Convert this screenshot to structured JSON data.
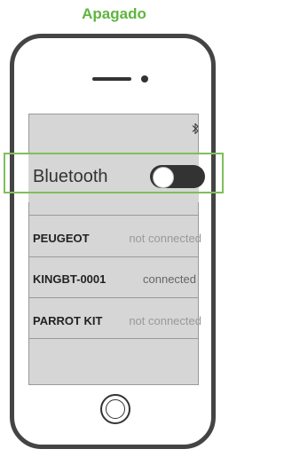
{
  "state_label": "Apagado",
  "bluetooth": {
    "label": "Bluetooth",
    "enabled": false
  },
  "devices": [
    {
      "name": "PEUGEOT",
      "status": "not connected"
    },
    {
      "name": "KINGBT-0001",
      "status": "connected"
    },
    {
      "name": "PARROT KIT",
      "status": "not connected"
    }
  ],
  "icons": {
    "status": "bluetooth-icon",
    "home": "home-button"
  },
  "colors": {
    "title": "#5fb53f",
    "highlight": "#7dbf5c",
    "screen": "#d6d6d6",
    "toggle_off": "#333333"
  }
}
